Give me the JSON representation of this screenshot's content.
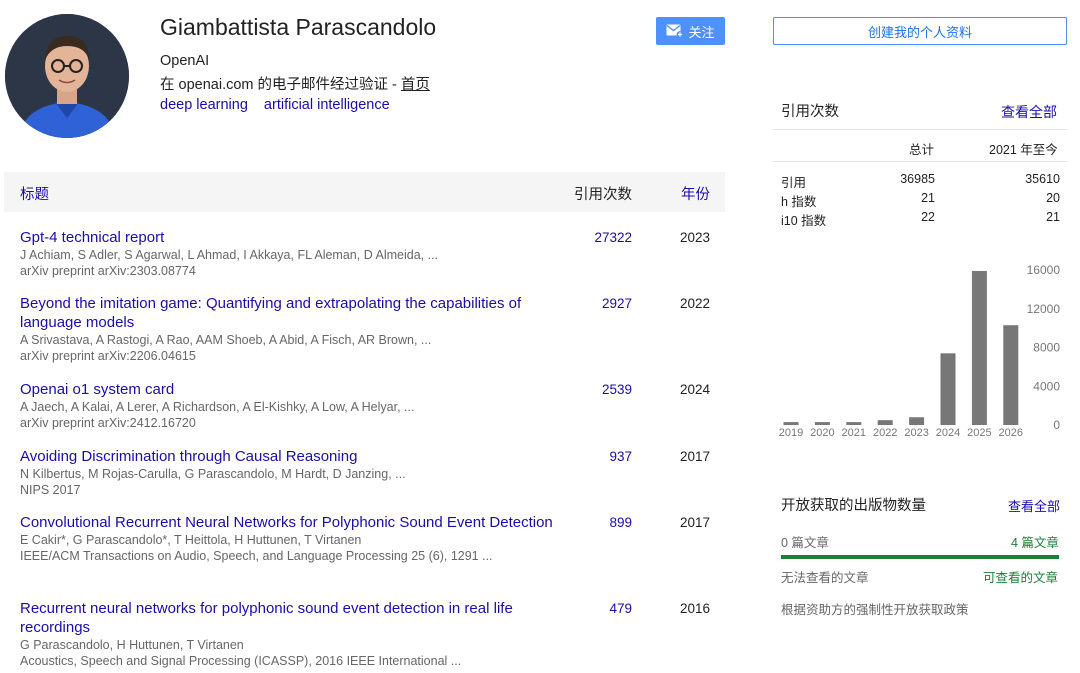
{
  "profile": {
    "name": "Giambattista Parascandolo",
    "affiliation": "OpenAI",
    "email_prefix": "在 openai.com 的电子邮件经过验证 - ",
    "home_link": "首页",
    "interests": [
      "deep learning",
      "artificial intelligence"
    ]
  },
  "buttons": {
    "follow": "关注",
    "create_profile": "创建我的个人资料"
  },
  "table": {
    "headers": {
      "title": "标题",
      "cited_by": "引用次数",
      "year": "年份"
    },
    "articles": [
      {
        "title": "Gpt-4 technical report",
        "authors": "J Achiam, S Adler, S Agarwal, L Ahmad, I Akkaya, FL Aleman, D Almeida, ...",
        "venue": "arXiv preprint arXiv:2303.08774",
        "cited": "27322",
        "year": "2023"
      },
      {
        "title": "Beyond the imitation game: Quantifying and extrapolating the capabilities of language models",
        "authors": "A Srivastava, A Rastogi, A Rao, AAM Shoeb, A Abid, A Fisch, AR Brown, ...",
        "venue": "arXiv preprint arXiv:2206.04615",
        "cited": "2927",
        "year": "2022"
      },
      {
        "title": "Openai o1 system card",
        "authors": "A Jaech, A Kalai, A Lerer, A Richardson, A El-Kishky, A Low, A Helyar, ...",
        "venue": "arXiv preprint arXiv:2412.16720",
        "cited": "2539",
        "year": "2024"
      },
      {
        "title": "Avoiding Discrimination through Causal Reasoning",
        "authors": "N Kilbertus, M Rojas-Carulla, G Parascandolo, M Hardt, D Janzing, ...",
        "venue": "NIPS 2017",
        "cited": "937",
        "year": "2017"
      },
      {
        "title": "Convolutional Recurrent Neural Networks for Polyphonic Sound Event Detection",
        "authors": "E Cakir*, G Parascandolo*, T Heittola, H Huttunen, T Virtanen",
        "venue": "IEEE/ACM Transactions on Audio, Speech, and Language Processing 25 (6), 1291 ...",
        "cited": "899",
        "year": "2017"
      },
      {
        "title": "Recurrent neural networks for polyphonic sound event detection in real life recordings",
        "authors": "G Parascandolo, H Huttunen, T Virtanen",
        "venue": "Acoustics, Speech and Signal Processing (ICASSP), 2016 IEEE International ...",
        "cited": "479",
        "year": "2016"
      }
    ]
  },
  "citations": {
    "title": "引用次数",
    "view_all": "查看全部",
    "col_all": "总计",
    "col_since": "2021 年至今",
    "rows": [
      {
        "label": "引用",
        "all": "36985",
        "since": "35610"
      },
      {
        "label": "h 指数",
        "all": "21",
        "since": "20"
      },
      {
        "label": "i10 指数",
        "all": "22",
        "since": "21"
      }
    ]
  },
  "chart_data": {
    "type": "bar",
    "categories": [
      "2019",
      "2020",
      "2021",
      "2022",
      "2023",
      "2024",
      "2025",
      "2026"
    ],
    "values": [
      300,
      300,
      300,
      500,
      800,
      7400,
      15900,
      10300
    ],
    "ylim": [
      0,
      16000
    ],
    "yticks": [
      "16000",
      "12000",
      "8000",
      "4000",
      "0"
    ],
    "bar_color": "#777777"
  },
  "open_access": {
    "title": "开放获取的出版物数量",
    "view_all": "查看全部",
    "unavailable_count": "0 篇文章",
    "available_count": "4 篇文章",
    "unavailable_label": "无法查看的文章",
    "available_label": "可查看的文章",
    "mandate_text": "根据资助方的强制性开放获取政策",
    "bar_color": "#188038"
  }
}
